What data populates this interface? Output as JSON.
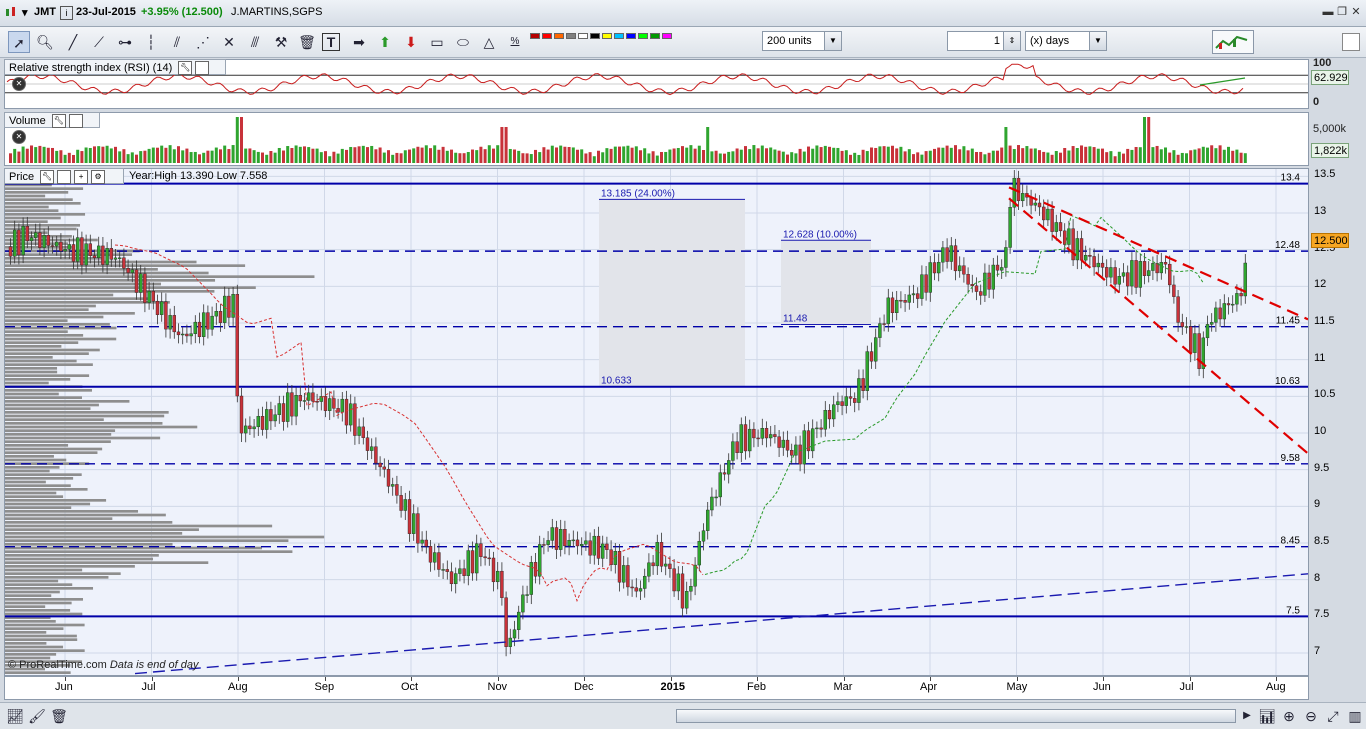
{
  "titlebar": {
    "symbol": "JMT",
    "date": "23-Jul-2015",
    "change": "+3.95% (12.500)",
    "name": "J.MARTINS,SGPS"
  },
  "toolbar": {
    "units_value": "200 units",
    "count_value": "1",
    "period_value": "(x) days",
    "icons": [
      "cursor-icon",
      "zoom-icon",
      "line-icon",
      "ray-icon",
      "horizontal-line-icon",
      "vertical-line-icon",
      "channel-icon",
      "fan-icon",
      "cross-icon",
      "tools-icon",
      "delete-icon",
      "text-icon",
      "arrow-right-icon",
      "arrow-up-icon",
      "arrow-down-icon",
      "rectangle-icon",
      "ellipse-icon",
      "triangle-icon",
      "fibonacci-icon"
    ],
    "colors": [
      "#b40000",
      "#ff0000",
      "#ff6600",
      "#808080",
      "#ffffff",
      "#000000",
      "#ffff00",
      "#00c0ff",
      "#0000ff",
      "#00ff00",
      "#009900",
      "#ff00ff"
    ]
  },
  "rsi": {
    "label": "Relative strength index (RSI) (14)",
    "scale_top": "100",
    "scale_bottom": "0",
    "current": "62.929"
  },
  "volume": {
    "label": "Volume",
    "scale": "5,000k",
    "current": "1,822k"
  },
  "price": {
    "label": "Price",
    "year_info": "Year:High 13.390 Low 7.558",
    "last_tag": "12.500",
    "watermark": "© ProRealTime.com",
    "watermark_note": "Data is end of day",
    "y_ticks": [
      "13.5",
      "13",
      "12.5",
      "12",
      "11.5",
      "11",
      "10.5",
      "10",
      "9.5",
      "9",
      "8.5",
      "8",
      "7.5",
      "7"
    ],
    "levels": [
      {
        "label": "13.4",
        "value": 13.4,
        "style": "solid"
      },
      {
        "label": "12.48",
        "value": 12.48,
        "style": "dash"
      },
      {
        "label": "11.45",
        "value": 11.45,
        "style": "dash"
      },
      {
        "label": "10.63",
        "value": 10.63,
        "style": "solid"
      },
      {
        "label": "9.58",
        "value": 9.58,
        "style": "dash"
      },
      {
        "label": "8.45",
        "value": 8.45,
        "style": "dash"
      },
      {
        "label": "7.5",
        "value": 7.5,
        "style": "solid"
      }
    ],
    "box_labels": [
      "13.185 (24.00%)",
      "12.628 (10.00%)",
      "11.48",
      "10.633"
    ],
    "x_labels": [
      "Jun",
      "Jul",
      "Aug",
      "Sep",
      "Oct",
      "Nov",
      "Dec",
      "2015",
      "Feb",
      "Mar",
      "Apr",
      "May",
      "Jun",
      "Jul",
      "Aug"
    ]
  },
  "chart_data": {
    "type": "candlestick",
    "title": "Price",
    "ylim": [
      6.7,
      13.6
    ],
    "levels": [
      13.4,
      12.48,
      11.45,
      10.63,
      9.58,
      8.45,
      7.5
    ],
    "series": [
      {
        "name": "Price",
        "x": [
          "Jun",
          "Jul",
          "Aug",
          "Sep",
          "Oct",
          "Nov",
          "Dec",
          "2015",
          "Feb",
          "Mar",
          "Apr",
          "May",
          "Jun",
          "Jul",
          "Aug"
        ],
        "values": [
          12.6,
          12.3,
          11.6,
          10.4,
          9.0,
          8.2,
          8.3,
          8.2,
          10.0,
          10.5,
          12.2,
          13.2,
          12.2,
          11.6,
          12.5
        ]
      }
    ],
    "year_high": 13.39,
    "year_low": 7.558
  }
}
